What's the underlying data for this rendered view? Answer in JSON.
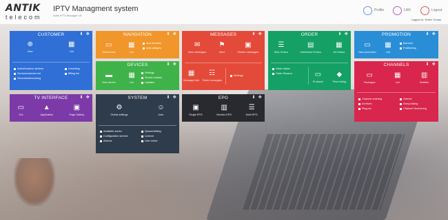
{
  "header": {
    "logo_word": "ANTIK",
    "logo_sub": "telecom",
    "app_title": "IPTV Managment system",
    "app_subtitle": "Antik IPTV Manager v5",
    "profile_label": "Profile",
    "lan_label": "LAN",
    "logout_label": "Logout",
    "logged_in": "Logged in: Tester Tomas"
  },
  "tiles": {
    "customer": {
      "title": "CUSTOMER",
      "items": [
        {
          "label": "New",
          "icon": "plus-circle-icon"
        },
        {
          "label": "List",
          "icon": "grid-icon"
        }
      ],
      "links": [
        "Active/inactive devices",
        "Device/customer list",
        "Scheduled/incoming"
      ],
      "links2": [
        "Unlocking",
        "Billing list"
      ]
    },
    "navigation": {
      "title": "NAVIGATION",
      "items": [
        {
          "label": "Dashboard",
          "icon": "image-icon"
        },
        {
          "label": "List",
          "icon": "grid-icon"
        }
      ],
      "links": [
        "Add favorites",
        "Add category"
      ]
    },
    "devices": {
      "title": "DEVICES",
      "items": [
        {
          "label": "New device",
          "icon": "box-icon"
        },
        {
          "label": "List",
          "icon": "grid-icon"
        }
      ],
      "links": [
        "Settings",
        "Device models",
        "Updates"
      ]
    },
    "messages": {
      "title": "MESSAGES",
      "items": [
        {
          "label": "New messages",
          "icon": "envelope-icon"
        },
        {
          "label": "Alert",
          "icon": "alert-icon"
        },
        {
          "label": "Device messages",
          "icon": "chat-icon"
        }
      ],
      "items2": [
        {
          "label": "Message lists",
          "icon": "grid-icon"
        },
        {
          "label": "Ticker messages",
          "icon": "sliders-icon"
        }
      ],
      "links": [
        "Settings"
      ]
    },
    "order": {
      "title": "ORDER",
      "items": [
        {
          "label": "New Orders",
          "icon": "list-icon"
        },
        {
          "label": "Unfinished Orders",
          "icon": "document-icon"
        },
        {
          "label": "All Orders",
          "icon": "grid-icon"
        }
      ],
      "links": [
        "Order status",
        "Order Reason"
      ],
      "items2": [
        {
          "label": "Products",
          "icon": "box-icon"
        },
        {
          "label": "Price listing",
          "icon": "tag-icon"
        }
      ]
    },
    "promotion": {
      "title": "PROMOTION",
      "items": [
        {
          "label": "New promotion",
          "icon": "image-icon"
        },
        {
          "label": "List",
          "icon": "grid-icon"
        }
      ],
      "links": [
        "Banners",
        "Positioning"
      ]
    },
    "channels": {
      "title": "CHANNELS",
      "items": [
        {
          "label": "Packages",
          "icon": "box-icon"
        },
        {
          "label": "List",
          "icon": "grid-icon"
        },
        {
          "label": "Statistic",
          "icon": "bar-chart-icon"
        }
      ],
      "links": [
        "Channel ordering",
        "Archives",
        "Plug-ins"
      ],
      "links2": [
        "Genres",
        "Group listing",
        "Channel Numbering"
      ]
    },
    "tv_interface": {
      "title": "TV INTERFACE",
      "items": [
        {
          "label": "Gui",
          "icon": "monitor-icon"
        },
        {
          "label": "Application",
          "icon": "road-icon"
        },
        {
          "label": "Page Gallery",
          "icon": "gallery-icon"
        }
      ]
    },
    "system": {
      "title": "SYSTEM",
      "items": [
        {
          "label": "Global settings",
          "icon": "gears-icon"
        },
        {
          "label": "User",
          "icon": "users-icon"
        }
      ],
      "links": [
        "Available zones",
        "Configuration service",
        "Actions"
      ],
      "links2": [
        "Queue/setting",
        "Licence",
        "User notes"
      ]
    },
    "epg": {
      "title": "EPG",
      "items": [
        {
          "label": "Single EPG",
          "icon": "tv-icon"
        },
        {
          "label": "Monitor EPG",
          "icon": "bar-chart-icon"
        },
        {
          "label": "Multi EPG",
          "icon": "list-icon"
        }
      ]
    }
  },
  "colors": {
    "customer": "#2f6fd6",
    "navigation": "#f0962a",
    "devices": "#3fb24a",
    "messages": "#e44a39",
    "order": "#15a065",
    "promotion": "#2a8ed6",
    "channels": "#d8264d",
    "tv_interface": "#7c3aa8",
    "system": "#2e3c4c",
    "epg": "#282a2f"
  }
}
